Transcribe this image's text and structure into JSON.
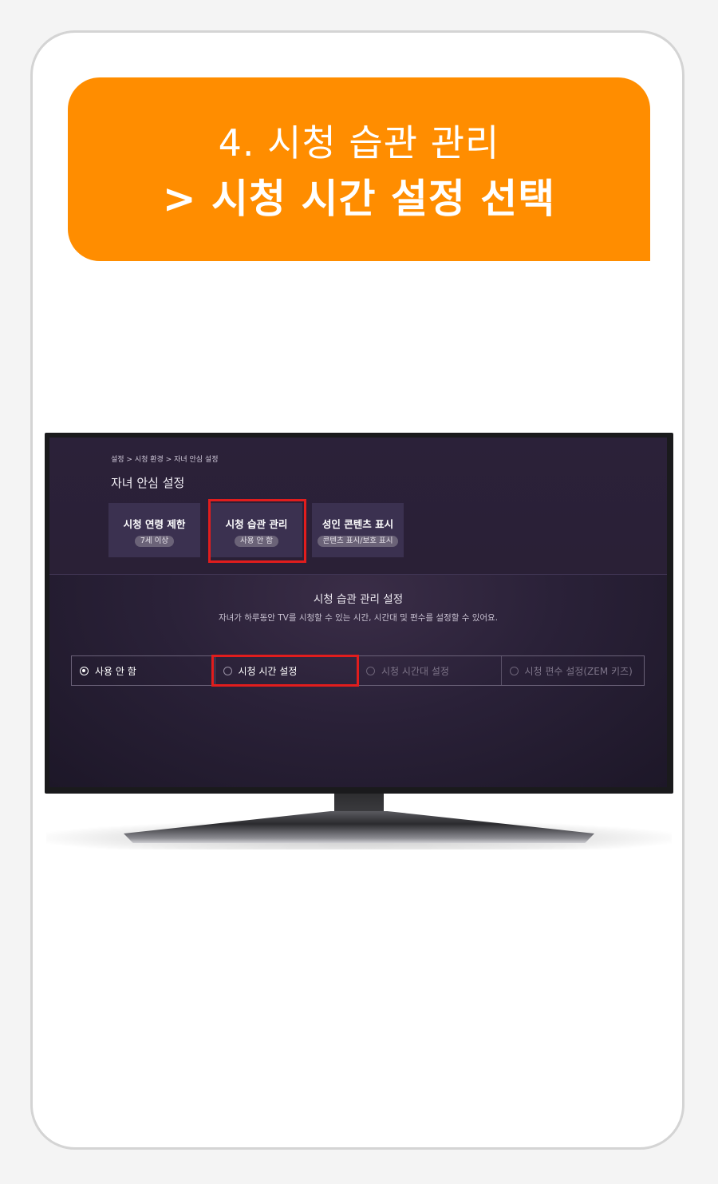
{
  "banner": {
    "line1": "4. 시청 습관 관리",
    "line2": "> 시청 시간 설정 선택"
  },
  "tv_screen": {
    "breadcrumb": "설정 > 시청 환경 > 자녀 안심 설정",
    "title": "자녀 안심 설정",
    "categories": [
      {
        "name": "시청 연령 제한",
        "value": "7세 이상"
      },
      {
        "name": "시청 습관 관리",
        "value": "사용 안 함"
      },
      {
        "name": "성인 콘텐츠 표시",
        "value": "콘텐츠 표시/보호 표시"
      }
    ],
    "section_title": "시청 습관 관리 설정",
    "section_desc": "자녀가 하루동안 TV를 시청할 수 있는 시간, 시간대 및 편수를 설정할 수 있어요.",
    "options": [
      {
        "label": "사용 안 함",
        "selected": true,
        "enabled": true
      },
      {
        "label": "시청 시간 설정",
        "selected": false,
        "enabled": true
      },
      {
        "label": "시청 시간대 설정",
        "selected": false,
        "enabled": false
      },
      {
        "label": "시청 편수 설정(ZEM 키즈)",
        "selected": false,
        "enabled": false
      }
    ]
  },
  "colors": {
    "banner": "#ff8d00",
    "highlight": "#e11d1d",
    "screen_bg": "#2a2138"
  }
}
